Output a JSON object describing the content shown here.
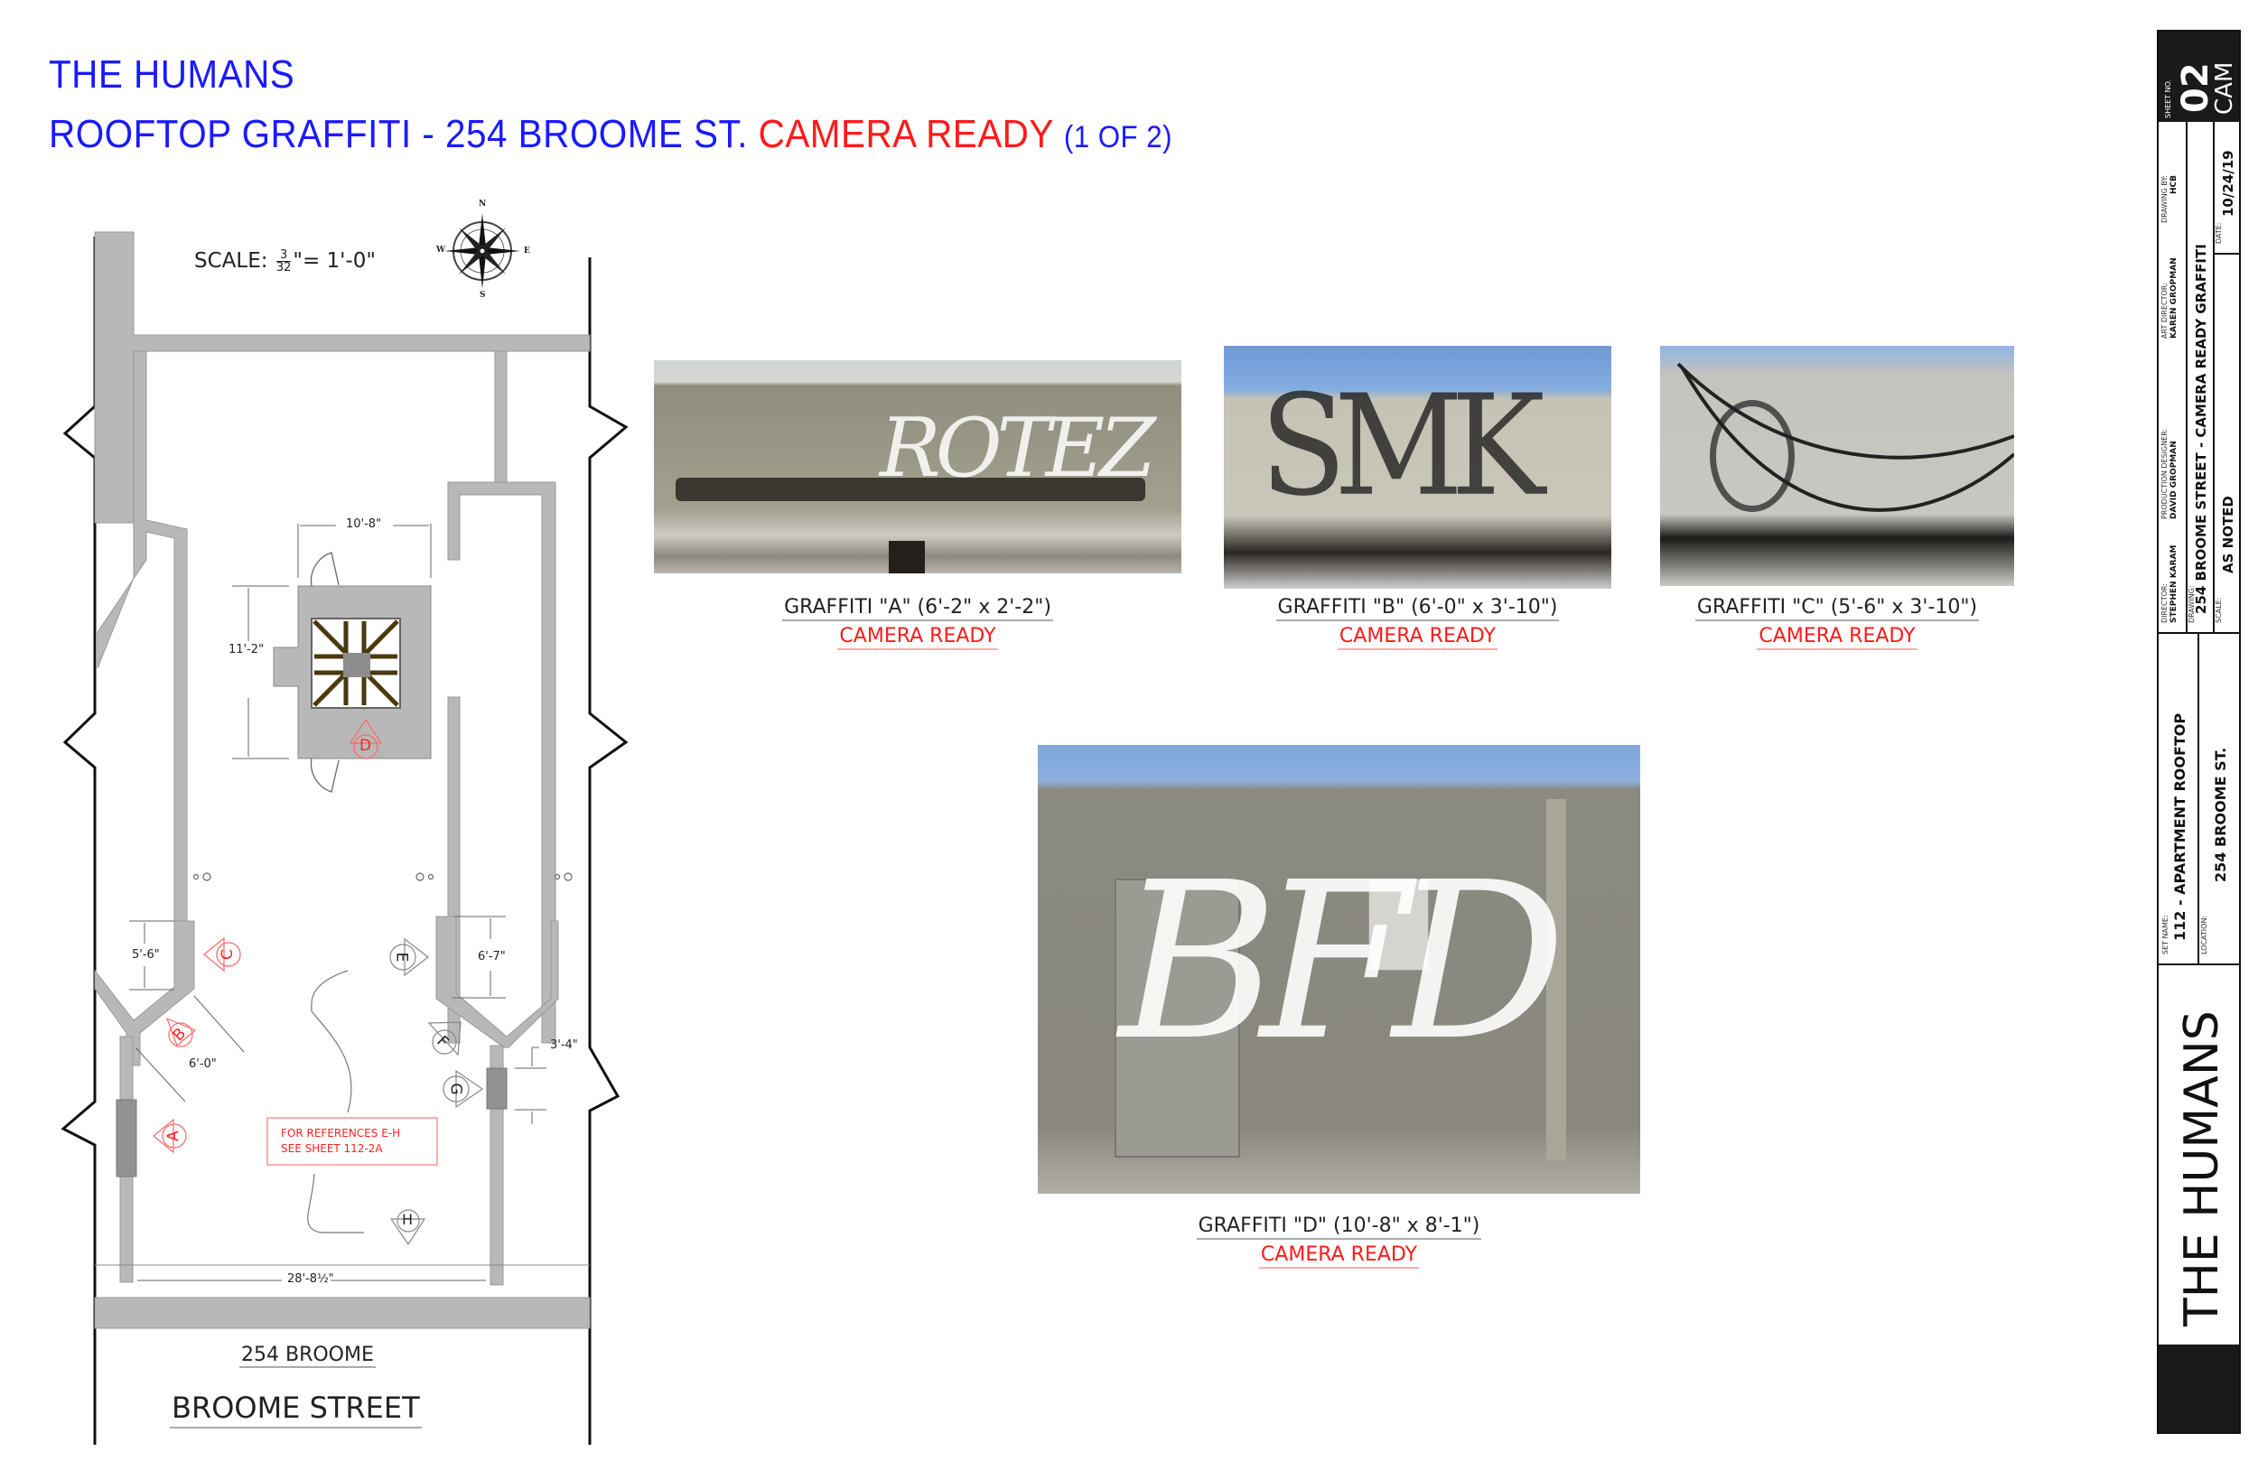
{
  "header": {
    "line1": "THE HUMANS",
    "line2_blue": "ROOFTOP GRAFFITI - 254 BROOME ST.",
    "line2_red": "CAMERA READY",
    "line2_page": "(1 OF 2)",
    "colors": {
      "blue": "#1a1aff",
      "red": "#ff1a1a"
    }
  },
  "plan": {
    "scale_label": "SCALE:",
    "scale_num": "3",
    "scale_den": "32",
    "scale_rest": "\"= 1'-0\"",
    "compass": {
      "n": "N",
      "s": "S",
      "e": "E",
      "w": "W"
    },
    "dims": {
      "bulkhead_width": "10'-8\"",
      "bulkhead_depth": "11'-2\"",
      "c_span": "5'-6\"",
      "b_span": "6'-0\"",
      "e_span": "6'-7\"",
      "g_span": "3'-4\"",
      "total_width": "28'-8½\""
    },
    "markers": [
      "A",
      "B",
      "C",
      "D",
      "E",
      "F",
      "G",
      "H"
    ],
    "note_line1": "FOR REFERENCES E-H",
    "note_line2": "SEE SHEET 112-2A",
    "building_label": "254 BROOME",
    "street_label": "BROOME STREET"
  },
  "photos": [
    {
      "id": "A",
      "caption": "GRAFFITI \"A\" (6'-2\" x 2'-2\")",
      "status": "CAMERA READY",
      "tag": "ROTEZ"
    },
    {
      "id": "B",
      "caption": "GRAFFITI \"B\" (6'-0\" x 3'-10\")",
      "status": "CAMERA READY",
      "tag": "SMK"
    },
    {
      "id": "C",
      "caption": "GRAFFITI \"C\" (5'-6\" x 3'-10\")",
      "status": "CAMERA READY",
      "tag": "O"
    },
    {
      "id": "D",
      "caption": "GRAFFITI \"D\" (10'-8\" x 8'-1\")",
      "status": "CAMERA READY",
      "tag": "BFD"
    }
  ],
  "titleblock": {
    "sheet_no_label": "SHEET NO.",
    "sheet_no": "02",
    "sheet_suffix": "CAM",
    "director_label": "DIRECTOR:",
    "director": "STEPHEN KARAM",
    "production_designer_label": "PRODUCTION DESIGNER:",
    "production_designer": "DAVID GROPMAN",
    "art_director_label": "ART DIRECTOR:",
    "art_director": "KAREN GROPMAN",
    "drawing_by_label": "DRAWING BY:",
    "drawing_by": "HCB",
    "drawing_label": "DRAWING:",
    "drawing": "254 BROOME STREET - CAMERA  READY GRAFFITI",
    "scale_label": "SCALE:",
    "scale": "AS NOTED",
    "date_label": "DATE:",
    "date": "10/24/19",
    "set_name_label": "SET NAME:",
    "set_name": "112 - APARTMENT ROOFTOP",
    "location_label": "LOCATION:",
    "location": "254 BROOME ST.",
    "show_title": "THE HUMANS"
  }
}
